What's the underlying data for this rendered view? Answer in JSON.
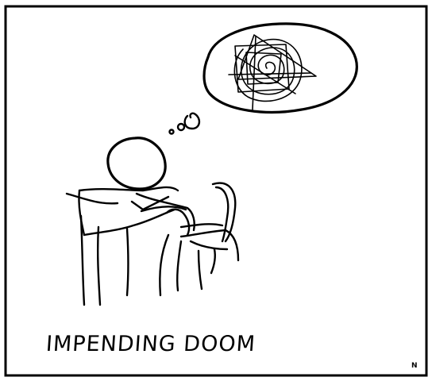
{
  "comic": {
    "caption": "IMPENDING DOOM",
    "signature": "N"
  },
  "colors": {
    "ink": "#000000",
    "paper": "#ffffff"
  }
}
